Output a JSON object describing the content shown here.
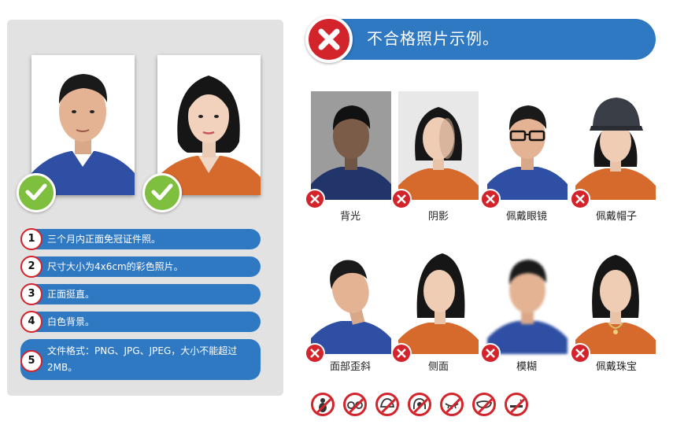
{
  "header": {
    "title": "不合格照片示例。"
  },
  "rules": [
    {
      "num": "1",
      "text": "三个月内正面免冠证件照。"
    },
    {
      "num": "2",
      "text": "尺寸大小为4x6cm的彩色照片。"
    },
    {
      "num": "3",
      "text": "正面挺直。"
    },
    {
      "num": "4",
      "text": "白色背景。"
    },
    {
      "num": "5",
      "text": "文件格式：PNG、JPG、JPEG，大小不能超过2MB。"
    }
  ],
  "bad_examples": [
    {
      "label": "背光"
    },
    {
      "label": "阴影"
    },
    {
      "label": "佩戴眼镜"
    },
    {
      "label": "佩戴帽子"
    },
    {
      "label": "面部歪斜"
    },
    {
      "label": "侧面"
    },
    {
      "label": "模糊"
    },
    {
      "label": "佩戴珠宝"
    }
  ],
  "forbidden_icons": [
    "no-pregnancy-icon",
    "no-glasses-icon",
    "no-hat-icon",
    "no-hair-cover-icon",
    "no-eye-closed-icon",
    "no-mask-icon",
    "no-smoking-icon"
  ],
  "colors": {
    "blue": "#2f78c2",
    "red": "#d3242c",
    "green": "#7fbf3f",
    "panel": "#e2e2e2"
  }
}
